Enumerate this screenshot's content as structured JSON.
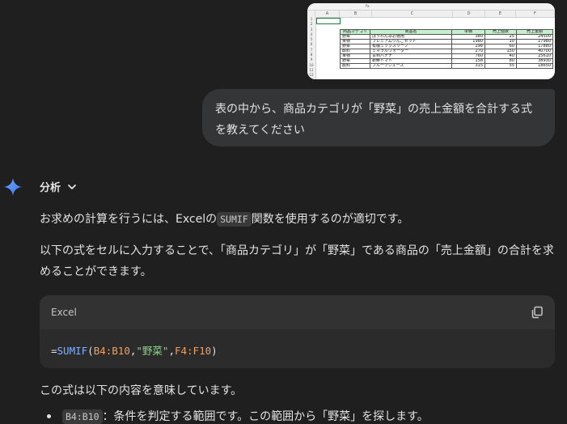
{
  "thumbnail": {
    "formula_bar": "fx",
    "columns": [
      "A",
      "B",
      "C",
      "D",
      "E",
      "F"
    ],
    "row_numbers": [
      "1",
      "2",
      "3",
      "4",
      "5",
      "6",
      "7",
      "8",
      "9",
      "10",
      "11",
      "12"
    ],
    "headers": [
      "商品カテゴリ",
      "商品名",
      "単価",
      "売上個数",
      "売上金額"
    ],
    "rows": [
      [
        "野菜",
        "ほうれん草お徳用",
        "380",
        "25",
        "24500"
      ],
      [
        "果物",
        "プレミアムりんごセット",
        "1980",
        "10",
        "27980"
      ],
      [
        "野菜",
        "有機ミックスリーフ",
        "298",
        "60",
        "17880"
      ],
      [
        "飲料",
        "ミネラルウォーター",
        "270",
        "150",
        "40700"
      ],
      [
        "果物",
        "甘熟バナナ",
        "760",
        "40",
        "25610"
      ],
      [
        "野菜",
        "新鮮トマト",
        "158",
        "80",
        "38930"
      ],
      [
        "飲料",
        "フルーツジュース",
        "315",
        "55",
        "18650"
      ]
    ]
  },
  "user_message": "表の中から、商品カテゴリが「野菜」の売上金額を合計する式を教えてください",
  "assistant": {
    "analysis_label": "分析",
    "para1_before": "お求めの計算を行うには、Excelの",
    "para1_code": "SUMIF",
    "para1_after": "関数を使用するのが適切です。",
    "para2": "以下の式をセルに入力することで、「商品カテゴリ」が「野菜」である商品の「売上金額」の合計を求めることができます。",
    "code_block": {
      "language": "Excel",
      "parts": {
        "eq": "=",
        "fn": "SUMIF",
        "open": "(",
        "ref1": "B4:B10",
        "c1": ",",
        "str": "\"野菜\"",
        "c2": ",",
        "ref2": "F4:F10",
        "close": ")"
      }
    },
    "para3": "この式は以下の内容を意味しています。",
    "bullet1_code": "B4:B10",
    "bullet1_text": "：条件を判定する範囲です。この範囲から「野菜」を探します。"
  },
  "icons": {
    "sparkle": "sparkle-icon",
    "chevron": "chevron-down-icon",
    "copy": "copy-icon"
  },
  "colors": {
    "background": "#1f1f1f",
    "bubble": "#333537",
    "sparkle": "#4a8df8"
  }
}
